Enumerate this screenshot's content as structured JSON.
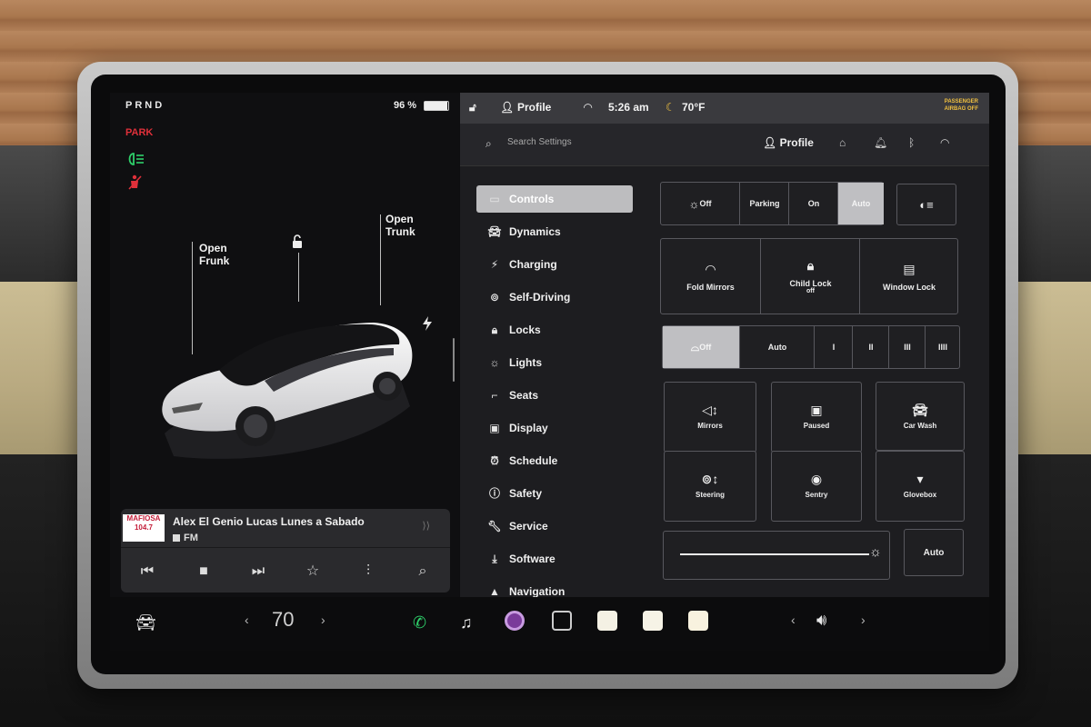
{
  "status": {
    "gear": "PRND",
    "park": "PARK",
    "battery": "96 %",
    "battery_level": 0.96
  },
  "car": {
    "frunk_label": "Open\nFrunk",
    "trunk_label": "Open\nTrunk"
  },
  "media": {
    "station_logo": "MAFIOSA 104.7",
    "title": "Alex El Genio Lucas Lunes a Sabado",
    "source": "FM"
  },
  "topbar": {
    "profile": "Profile",
    "time": "5:26 am",
    "temperature": "70°F",
    "airbag": "PASSENGER AIRBAG OFF"
  },
  "search": {
    "placeholder": "Search Settings",
    "profile": "Profile"
  },
  "menu": [
    {
      "label": "Controls",
      "icon": "toggle-icon"
    },
    {
      "label": "Dynamics",
      "icon": "car-icon"
    },
    {
      "label": "Charging",
      "icon": "bolt-icon"
    },
    {
      "label": "Self-Driving",
      "icon": "steering-wheel-icon"
    },
    {
      "label": "Locks",
      "icon": "lock-icon"
    },
    {
      "label": "Lights",
      "icon": "sun-icon"
    },
    {
      "label": "Seats",
      "icon": "seat-icon"
    },
    {
      "label": "Display",
      "icon": "display-icon"
    },
    {
      "label": "Schedule",
      "icon": "alarm-icon"
    },
    {
      "label": "Safety",
      "icon": "info-icon"
    },
    {
      "label": "Service",
      "icon": "wrench-icon"
    },
    {
      "label": "Software",
      "icon": "download-icon"
    },
    {
      "label": "Navigation",
      "icon": "navigation-icon"
    }
  ],
  "controls": {
    "headlights": [
      "Off",
      "Parking",
      "On",
      "Auto"
    ],
    "headlights_selected": "Auto",
    "tiles1": [
      {
        "label": "Fold Mirrors",
        "sub": ""
      },
      {
        "label": "Child Lock",
        "sub": "off"
      },
      {
        "label": "Window Lock",
        "sub": ""
      }
    ],
    "wipers": [
      "Off",
      "Auto",
      "I",
      "II",
      "III",
      "IIII"
    ],
    "wipers_selected": "Off",
    "tiles2": [
      "Mirrors",
      "Paused",
      "Car Wash",
      "Steering",
      "Sentry",
      "Glovebox"
    ],
    "brightness_auto": "Auto"
  },
  "dock": {
    "temperature": "70"
  },
  "colors": {
    "accent_active": "#bdbdbf",
    "alert_red": "#e0303a",
    "indicator_green": "#2ed06a"
  }
}
